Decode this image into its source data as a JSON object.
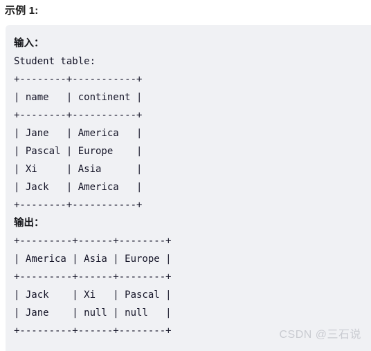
{
  "heading": "示例 1:",
  "input_block": {
    "label": "输入：",
    "caption": "Student table:",
    "lines": [
      "+--------+-----------+",
      "| name   | continent |",
      "+--------+-----------+",
      "| Jane   | America   |",
      "| Pascal | Europe    |",
      "| Xi     | Asia      |",
      "| Jack   | America   |",
      "+--------+-----------+"
    ],
    "table": {
      "columns": [
        "name",
        "continent"
      ],
      "rows": [
        [
          "Jane",
          "America"
        ],
        [
          "Pascal",
          "Europe"
        ],
        [
          "Xi",
          "Asia"
        ],
        [
          "Jack",
          "America"
        ]
      ]
    }
  },
  "output_block": {
    "label": "输出：",
    "lines": [
      "+---------+------+--------+",
      "| America | Asia | Europe |",
      "+---------+------+--------+",
      "| Jack    | Xi   | Pascal |",
      "| Jane    | null | null   |",
      "+---------+------+--------+"
    ],
    "table": {
      "columns": [
        "America",
        "Asia",
        "Europe"
      ],
      "rows": [
        [
          "Jack",
          "Xi",
          "Pascal"
        ],
        [
          "Jane",
          "null",
          "null"
        ]
      ]
    }
  },
  "watermark": "CSDN @三石说",
  "colors": {
    "panel_background": "#f0f1f4",
    "page_background": "#ffffff",
    "code_text": "#141427",
    "heading_text": "#1a1a1a",
    "watermark_text": "#c9cbd1"
  }
}
